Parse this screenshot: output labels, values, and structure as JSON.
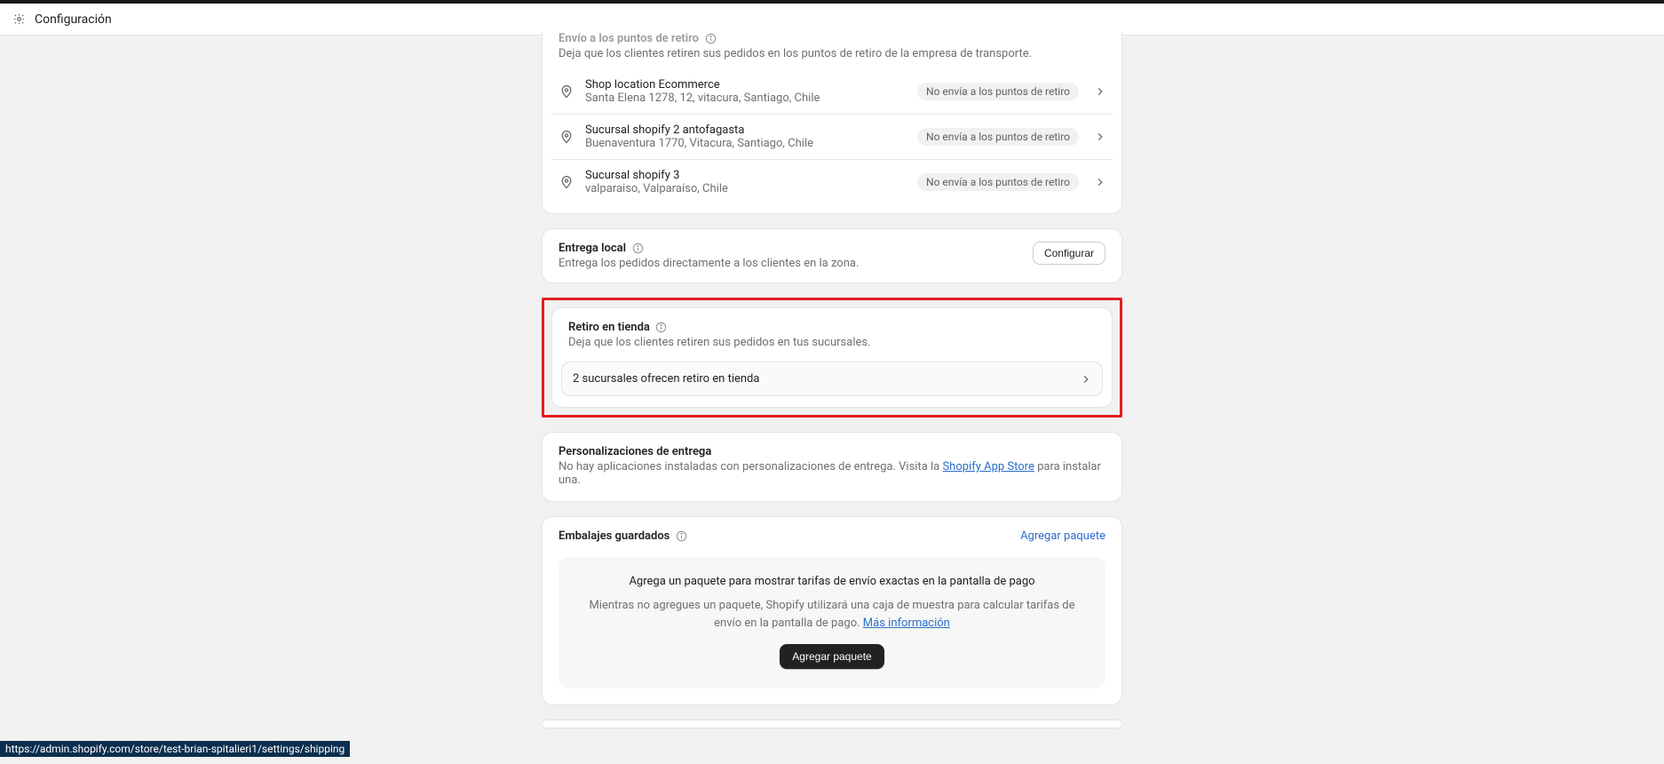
{
  "topbar": {
    "title": "Configuración"
  },
  "pickup_points": {
    "title": "Envío a los puntos de retiro",
    "subtitle": "Deja que los clientes retiren sus pedidos en los puntos de retiro de la empresa de transporte.",
    "badge_text": "No envía a los puntos de retiro",
    "locations": [
      {
        "name": "Shop location Ecommerce",
        "address": "Santa Elena 1278, 12, vitacura, Santiago, Chile"
      },
      {
        "name": "Sucursal shopify 2 antofagasta",
        "address": "Buenaventura 1770, Vitacura, Santiago, Chile"
      },
      {
        "name": "Sucursal shopify 3",
        "address": "valparaiso, Valparaíso, Chile"
      }
    ]
  },
  "local_delivery": {
    "title": "Entrega local",
    "subtitle": "Entrega los pedidos directamente a los clientes en la zona.",
    "configure_label": "Configurar"
  },
  "pickup_store": {
    "title": "Retiro en tienda",
    "subtitle": "Deja que los clientes retiren sus pedidos en tus sucursales.",
    "row_text": "2 sucursales ofrecen retiro en tienda"
  },
  "delivery_custom": {
    "title": "Personalizaciones de entrega",
    "text_before": "No hay aplicaciones instaladas con personalizaciones de entrega. Visita la ",
    "link_label": "Shopify App Store",
    "text_after": " para instalar una."
  },
  "packages": {
    "title": "Embalajes guardados",
    "add_link": "Agregar paquete",
    "empty_title": "Agrega un paquete para mostrar tarifas de envío exactas en la pantalla de pago",
    "empty_sub_before": "Mientras no agregues un paquete, Shopify utilizará una caja de muestra para calcular tarifas de envío en la pantalla de pago. ",
    "empty_sub_link": "Más información",
    "add_button": "Agregar paquete"
  },
  "statusbar": {
    "url": "https://admin.shopify.com/store/test-brian-spitalieri1/settings/shipping"
  }
}
